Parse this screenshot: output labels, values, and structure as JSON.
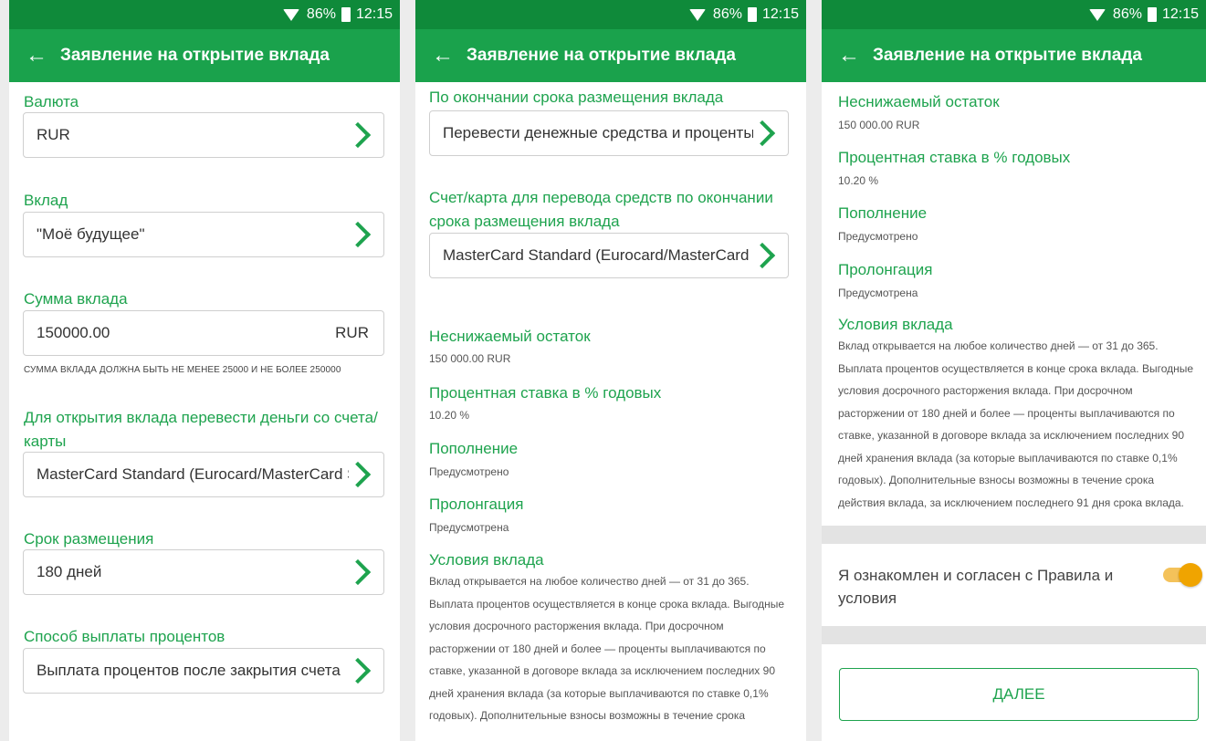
{
  "status": {
    "battery": "86%",
    "time": "12:15"
  },
  "screen_title": "Заявление на открытие вклада",
  "screen1": {
    "currency_label": "Валюта",
    "currency_value": "RUR",
    "deposit_label": "Вклад",
    "deposit_value": "\"Моё будущее\"",
    "amount_label": "Сумма вклада",
    "amount_value": "150000.00",
    "amount_currency": "RUR",
    "amount_hint": "СУММА ВКЛАДА ДОЛЖНА БЫТЬ НЕ МЕНЕЕ 25000 И НЕ БОЛЕЕ 250000",
    "source_label_line1": "Для открытия вклада перевести деньги со счета/",
    "source_label_line2": "карты",
    "source_value": "MasterCard Standard (Eurocard/MasterCard Standard)",
    "term_label": "Срок размещения",
    "term_value": "180 дней",
    "payout_label": "Способ выплаты процентов",
    "payout_value": "Выплата процентов после закрытия счета"
  },
  "screen2": {
    "end_label": "По окончании срока размещения вклада",
    "end_value": "Перевести денежные средства и проценты на счет",
    "account_label_line1": "Счет/карта для перевода средств по окончании",
    "account_label_line2": "срока размещения вклада",
    "account_value": "MasterCard Standard (Eurocard/MasterCard Standard)"
  },
  "info": {
    "min_balance_label": "Неснижаемый остаток",
    "min_balance_value": "150 000.00 RUR",
    "rate_label": "Процентная ставка в % годовых",
    "rate_value": "10.20 %",
    "topup_label": "Пополнение",
    "topup_value": "Предусмотрено",
    "prolong_label": "Пролонгация",
    "prolong_value": "Предусмотрена",
    "conditions_label": "Условия вклада",
    "conditions_lines": [
      "Вклад открывается на любое количество дней — от 31 до 365.",
      "Выплата процентов осуществляется в конце срока вклада. Выгодные",
      "условия досрочного расторжения вклада. При досрочном",
      "расторжении от 180 дней и более — проценты выплачиваются по",
      "ставке, указанной в договоре вклада за исключением последних 90",
      "дней хранения вклада (за которые выплачиваются по ставке 0,1%",
      "годовых). Дополнительные взносы возможны в течение срока",
      "действия вклада, за исключением последнего 91 дня срока вклада."
    ]
  },
  "screen3": {
    "agree_line1": "Я ознакомлен и согласен с Правила и",
    "agree_line2": "условия",
    "agree_on": true,
    "next_button": "ДАЛЕЕ"
  }
}
